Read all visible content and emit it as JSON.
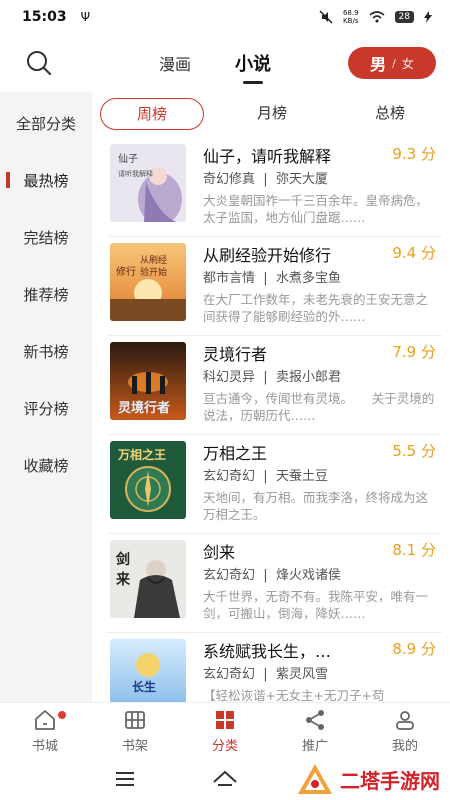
{
  "status_bar": {
    "time": "15:03",
    "usb_glyph": "Ψ",
    "net_speed_value": "68.9",
    "net_speed_unit": "KB/s",
    "battery": "28"
  },
  "header": {
    "tabs": [
      {
        "label": "漫画"
      },
      {
        "label": "小说"
      }
    ],
    "active_tab": "小说",
    "gender_toggle": {
      "male": "男",
      "sep": "/",
      "female": "女"
    }
  },
  "sidebar": {
    "items": [
      {
        "label": "全部分类"
      },
      {
        "label": "最热榜"
      },
      {
        "label": "完结榜"
      },
      {
        "label": "推荐榜"
      },
      {
        "label": "新书榜"
      },
      {
        "label": "评分榜"
      },
      {
        "label": "收藏榜"
      }
    ],
    "active": "最热榜"
  },
  "rank_tabs": [
    {
      "label": "周榜"
    },
    {
      "label": "月榜"
    },
    {
      "label": "总榜"
    }
  ],
  "books": [
    {
      "title": "仙子，请听我解释",
      "score": "9.3 分",
      "genre": "奇幻修真",
      "author": "弥天大厦",
      "desc": "大炎皇朝国祚一千三百余年。皇帝病危，太子监国，地方仙门盘踞……"
    },
    {
      "title": "从刷经验开始修行",
      "score": "9.4 分",
      "genre": "都市言情",
      "author": "水煮多宝鱼",
      "desc": "在大厂工作数年，未老先衰的王安无意之间获得了能够刷经验的外……"
    },
    {
      "title": "灵境行者",
      "score": "7.9 分",
      "genre": "科幻灵异",
      "author": "卖报小郎君",
      "desc": "亘古通今，传闻世有灵境。　　关于灵境的说法，历朝历代……"
    },
    {
      "title": "万相之王",
      "score": "5.5 分",
      "genre": "玄幻奇幻",
      "author": "天蚕土豆",
      "desc": "天地间，有万相。而我李洛，终将成为这万相之王。"
    },
    {
      "title": "剑来",
      "score": "8.1 分",
      "genre": "玄幻奇幻",
      "author": "烽火戏诸侯",
      "desc": "大千世界，无奇不有。我陈平安，唯有一剑，可搬山，倒海，降妖……"
    },
    {
      "title": "系统赋我长生，…",
      "score": "8.9 分",
      "genre": "玄幻奇幻",
      "author": "紫灵风雪",
      "desc": "【轻松诙谐+无女主+无刀子+苟"
    }
  ],
  "bottom_nav": [
    {
      "label": "书城",
      "icon": "home-icon"
    },
    {
      "label": "书架",
      "icon": "bookshelf-icon"
    },
    {
      "label": "分类",
      "icon": "category-icon"
    },
    {
      "label": "推广",
      "icon": "share-icon"
    },
    {
      "label": "我的",
      "icon": "profile-icon"
    }
  ],
  "watermark": {
    "text": "二塔手游网"
  },
  "colors": {
    "accent": "#c8392b",
    "score": "#e9a020",
    "sidebar_bg": "#f4f4f4"
  }
}
